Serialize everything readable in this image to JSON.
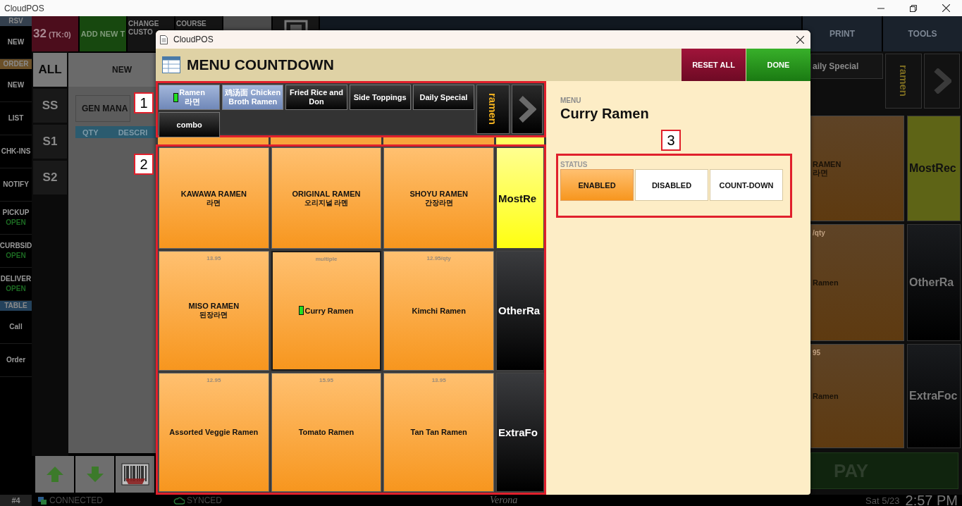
{
  "window": {
    "title": "CloudPOS"
  },
  "sidebar": {
    "items": [
      {
        "kind": "header",
        "label": "RSV",
        "color": "#34404e"
      },
      {
        "kind": "item",
        "label": "NEW"
      },
      {
        "kind": "header",
        "label": "ORDER",
        "color": "#6b5028"
      },
      {
        "kind": "item",
        "label": "NEW"
      },
      {
        "kind": "item",
        "label": "LIST"
      },
      {
        "kind": "item",
        "label": "CHK-INS"
      },
      {
        "kind": "item",
        "label": "NOTIFY"
      },
      {
        "kind": "item",
        "label": "PICKUP",
        "status": "OPEN"
      },
      {
        "kind": "item",
        "label": "CURBSID",
        "status": "OPEN"
      },
      {
        "kind": "item",
        "label": "DELIVER",
        "status": "OPEN"
      },
      {
        "kind": "header",
        "label": "TABLE",
        "color": "#24425c"
      },
      {
        "kind": "item",
        "label": "Call"
      },
      {
        "kind": "item",
        "label": "Order"
      }
    ]
  },
  "toolbar": {
    "left": [
      {
        "kind": "ticket",
        "label": "32",
        "sub": "(TK:0)"
      },
      {
        "kind": "add",
        "label": "ADD NEW T"
      },
      {
        "kind": "plain",
        "label": "CHANGE CUSTO"
      },
      {
        "kind": "plain",
        "label": "COURSE"
      },
      {
        "kind": "blank"
      },
      {
        "kind": "icon"
      }
    ],
    "right": [
      {
        "label": "PRINT"
      },
      {
        "label": "TOOLS"
      }
    ]
  },
  "seats": [
    {
      "label": "ALL",
      "selected": true
    },
    {
      "label": "SS",
      "selected": false
    },
    {
      "label": "S1",
      "selected": false
    },
    {
      "label": "S2",
      "selected": false
    }
  ],
  "order": {
    "header": "NEW",
    "customer": "GEN MANA",
    "columns": [
      "QTY",
      "DESCRI"
    ]
  },
  "background_menu": {
    "category": "aily Special",
    "group": "ramen",
    "tiles": [
      {
        "name": "RAMEN",
        "sub": "라면"
      },
      {
        "price": "/qty",
        "name": "Ramen"
      },
      {
        "price": "95",
        "name": "Ramen"
      }
    ],
    "sides": [
      {
        "label": "MostRec",
        "kind": "recent"
      },
      {
        "label": "OtherRa",
        "kind": "other"
      },
      {
        "label": "ExtraFoc",
        "kind": "other"
      }
    ],
    "pay": "PAY"
  },
  "dialog": {
    "title": "CloudPOS",
    "heading": "MENU COUNTDOWN",
    "buttons": [
      {
        "label": "RESET ALL",
        "kind": "reset"
      },
      {
        "label": "DONE",
        "kind": "done"
      }
    ],
    "categories": [
      {
        "label": "Ramen",
        "sub": "라면",
        "selected": true,
        "indicator": true
      },
      {
        "label": "鸡汤面 Chicken Broth Ramen",
        "selected": true,
        "indicator": false
      },
      {
        "label": "Fried Rice and Don",
        "selected": false,
        "indicator": false
      },
      {
        "label": "Side Toppings",
        "selected": false,
        "indicator": false
      },
      {
        "label": "Daily Special",
        "selected": false,
        "indicator": false
      },
      {
        "label": "combo",
        "selected": false,
        "indicator": false
      }
    ],
    "group": "ramen",
    "items": [
      {
        "name": "KAWAWA RAMEN",
        "sub": "라면",
        "selected": false,
        "indicator": false
      },
      {
        "name": "ORIGINAL RAMEN",
        "sub": "오리지널 라멘",
        "selected": false,
        "indicator": false
      },
      {
        "name": "SHOYU RAMEN",
        "sub": "간장라면",
        "selected": false,
        "indicator": false
      },
      {
        "price": "13.95",
        "name": "MISO RAMEN",
        "sub": "된장라면",
        "selected": false,
        "indicator": false
      },
      {
        "price": "multiple",
        "name": "Curry Ramen",
        "selected": true,
        "indicator": true
      },
      {
        "price": "12.95/qty",
        "name": "Kimchi Ramen",
        "selected": false,
        "indicator": false
      },
      {
        "price": "12.95",
        "name": "Assorted Veggie Ramen",
        "selected": false,
        "indicator": false
      },
      {
        "price": "15.95",
        "name": "Tomato Ramen",
        "selected": false,
        "indicator": false
      },
      {
        "price": "13.95",
        "name": "Tan Tan Ramen",
        "selected": false,
        "indicator": false
      }
    ],
    "sides": [
      {
        "label": "MostRe",
        "kind": "recent"
      },
      {
        "label": "OtherRa",
        "kind": "other"
      },
      {
        "label": "ExtraFo",
        "kind": "other"
      }
    ],
    "detail": {
      "label": "MENU",
      "name": "Curry Ramen",
      "status_label": "STATUS",
      "options": [
        {
          "label": "ENABLED",
          "selected": true
        },
        {
          "label": "DISABLED",
          "selected": false
        },
        {
          "label": "COUNT-DOWN",
          "selected": false
        }
      ]
    },
    "annotations": [
      "1",
      "2",
      "3"
    ]
  },
  "status_bar": {
    "station": "#4",
    "connection": "CONNECTED",
    "sync": "SYNCED",
    "location": "Verona",
    "date": "Sat 5/23",
    "time": "2:57 PM"
  }
}
